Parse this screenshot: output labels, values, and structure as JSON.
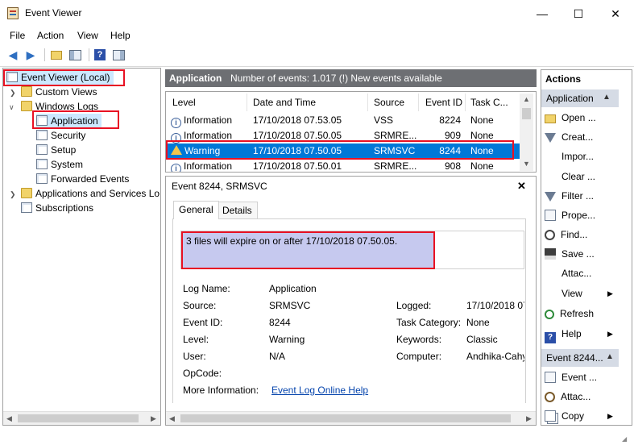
{
  "window": {
    "title": "Event Viewer",
    "minimize": "—",
    "maximize": "☐",
    "close": "✕"
  },
  "menu": [
    "File",
    "Action",
    "View",
    "Help"
  ],
  "tree": {
    "root": "Event Viewer (Local)",
    "custom_views": "Custom Views",
    "windows_logs": "Windows Logs",
    "logs": [
      "Application",
      "Security",
      "Setup",
      "System",
      "Forwarded Events"
    ],
    "apps_services": "Applications and Services Lo",
    "subscriptions": "Subscriptions"
  },
  "list_header": {
    "title": "Application",
    "info": "Number of events: 1.017 (!) New events available"
  },
  "columns": [
    "Level",
    "Date and Time",
    "Source",
    "Event ID",
    "Task C..."
  ],
  "events": [
    {
      "level": "Information",
      "date": "17/10/2018 07.53.05",
      "source": "VSS",
      "id": "8224",
      "task": "None"
    },
    {
      "level": "Information",
      "date": "17/10/2018 07.50.05",
      "source": "SRMRE...",
      "id": "909",
      "task": "None"
    },
    {
      "level": "Warning",
      "date": "17/10/2018 07.50.05",
      "source": "SRMSVC",
      "id": "8244",
      "task": "None"
    },
    {
      "level": "Information",
      "date": "17/10/2018 07.50.01",
      "source": "SRMRE...",
      "id": "908",
      "task": "None"
    }
  ],
  "detail": {
    "title": "Event 8244, SRMSVC",
    "close": "✕",
    "tabs": [
      "General",
      "Details"
    ],
    "description": "3 files will expire on or after 17/10/2018 07.50.05.",
    "labels": {
      "log_name": "Log Name:",
      "source": "Source:",
      "event_id": "Event ID:",
      "level": "Level:",
      "user": "User:",
      "opcode": "OpCode:",
      "more_info": "More Information:",
      "logged": "Logged:",
      "task_category": "Task Category:",
      "keywords": "Keywords:",
      "computer": "Computer:"
    },
    "values": {
      "log_name": "Application",
      "source": "SRMSVC",
      "event_id": "8244",
      "level": "Warning",
      "user": "N/A",
      "opcode": "",
      "more_info": "Event Log Online Help",
      "logged": "17/10/2018 07",
      "task_category": "None",
      "keywords": "Classic",
      "computer": "Andhika-Cahy"
    }
  },
  "actions": {
    "title": "Actions",
    "section1": "Application",
    "items1": [
      "Open ...",
      "Creat...",
      "Impor...",
      "Clear ...",
      "Filter ...",
      "Prope...",
      "Find...",
      "Save ...",
      "Attac...",
      "View",
      "Refresh",
      "Help"
    ],
    "section2": "Event 8244...",
    "items2": [
      "Event ...",
      "Attac...",
      "Copy"
    ]
  },
  "colors": {
    "highlight_red": "#e81123",
    "selection_blue": "#0078d7",
    "header_gray": "#6d6f73",
    "tree_select": "#cce8ff"
  }
}
